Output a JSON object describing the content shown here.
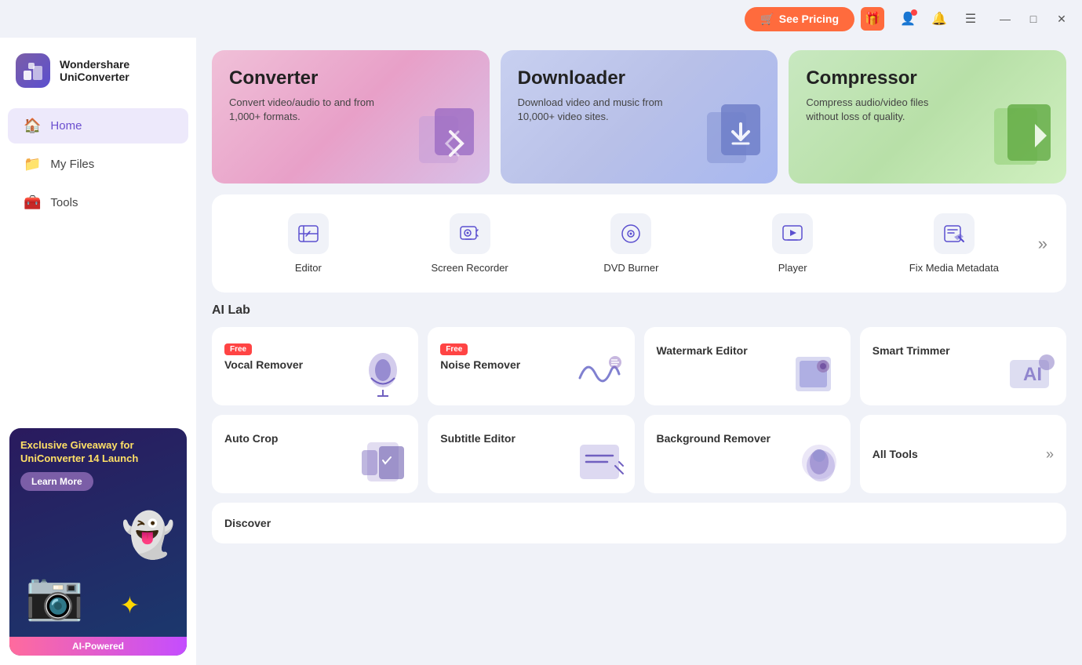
{
  "app": {
    "brand": "Wondershare",
    "product": "UniConverter"
  },
  "titlebar": {
    "see_pricing": "See Pricing",
    "cart_icon": "🛒",
    "gift_icon": "🎁",
    "profile_icon": "👤",
    "bell_icon": "🔔",
    "menu_icon": "☰",
    "minimize_icon": "—",
    "maximize_icon": "□",
    "close_icon": "✕"
  },
  "nav": {
    "items": [
      {
        "id": "home",
        "label": "Home",
        "icon": "🏠",
        "active": true
      },
      {
        "id": "my-files",
        "label": "My Files",
        "icon": "📁",
        "active": false
      },
      {
        "id": "tools",
        "label": "Tools",
        "icon": "🧰",
        "active": false
      }
    ]
  },
  "promo": {
    "title": "Exclusive Giveaway for UniConverter 14 Launch",
    "learn_more": "Learn More",
    "ai_badge": "AI-Powered"
  },
  "hero_cards": [
    {
      "id": "converter",
      "title": "Converter",
      "description": "Convert video/audio to and from 1,000+ formats.",
      "icon": "🔀",
      "type": "converter"
    },
    {
      "id": "downloader",
      "title": "Downloader",
      "description": "Download video and music from 10,000+ video sites.",
      "icon": "⬇",
      "type": "downloader"
    },
    {
      "id": "compressor",
      "title": "Compressor",
      "description": "Compress audio/video files without loss of quality.",
      "icon": "▶",
      "type": "compressor"
    }
  ],
  "tools": {
    "items": [
      {
        "id": "editor",
        "label": "Editor",
        "icon": "✂"
      },
      {
        "id": "screen-recorder",
        "label": "Screen Recorder",
        "icon": "🖥"
      },
      {
        "id": "dvd-burner",
        "label": "DVD Burner",
        "icon": "💿"
      },
      {
        "id": "player",
        "label": "Player",
        "icon": "▶"
      },
      {
        "id": "fix-media-metadata",
        "label": "Fix Media Metadata",
        "icon": "🔧"
      }
    ],
    "more_icon": "»"
  },
  "ai_lab": {
    "title": "AI Lab",
    "items": [
      {
        "id": "vocal-remover",
        "label": "Vocal Remover",
        "free": true,
        "icon": "🎤"
      },
      {
        "id": "noise-remover",
        "label": "Noise Remover",
        "free": true,
        "icon": "🔊"
      },
      {
        "id": "watermark-editor",
        "label": "Watermark Editor",
        "free": false,
        "icon": "📷"
      },
      {
        "id": "smart-trimmer",
        "label": "Smart Trimmer",
        "free": false,
        "icon": "🤖"
      },
      {
        "id": "auto-crop",
        "label": "Auto Crop",
        "free": false,
        "icon": "✂"
      },
      {
        "id": "subtitle-editor",
        "label": "Subtitle Editor",
        "free": false,
        "icon": "📝"
      },
      {
        "id": "background-remover",
        "label": "Background Remover",
        "free": false,
        "icon": "🖼"
      },
      {
        "id": "all-tools",
        "label": "All Tools",
        "free": false,
        "icon": "»"
      },
      {
        "id": "discover",
        "label": "Discover",
        "free": false,
        "icon": ""
      }
    ]
  }
}
